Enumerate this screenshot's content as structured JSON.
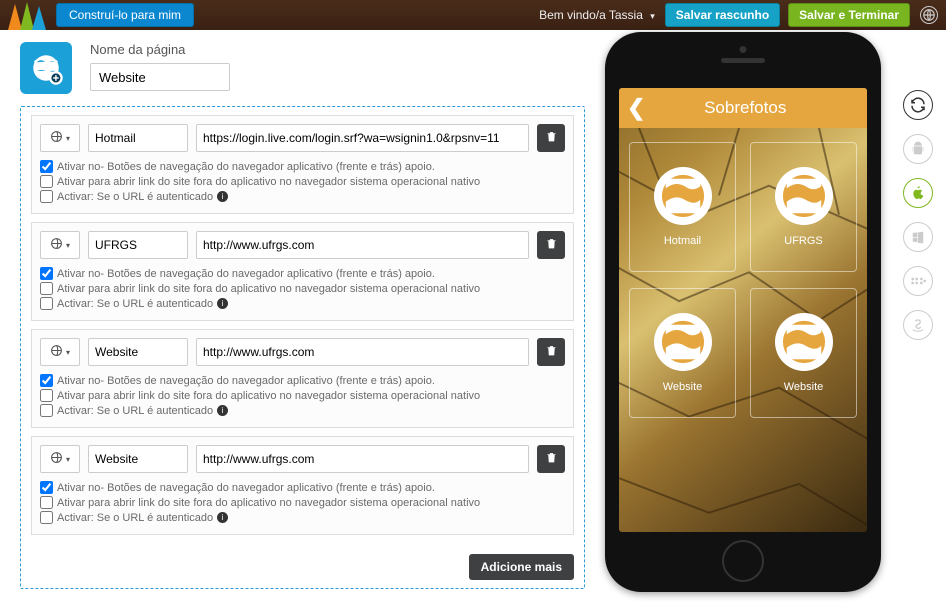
{
  "topbar": {
    "build_label": "Construí-lo para mim",
    "welcome": "Bem vindo/a Tassia",
    "save_draft": "Salvar rascunho",
    "save_finish": "Salvar e Terminar"
  },
  "page_head": {
    "label": "Nome da página",
    "value": "Website"
  },
  "checks": {
    "nav": "Ativar no- Botões de navegação do navegador aplicativo (frente e trás) apoio.",
    "ext": "Ativar para abrir link do site fora do aplicativo no navegador sistema operacional nativo",
    "auth": "Activar: Se o URL é autenticado"
  },
  "items": [
    {
      "name": "Hotmail",
      "url": "https://login.live.com/login.srf?wa=wsignin1.0&rpsnv=11",
      "nav": true,
      "ext": false,
      "auth": false
    },
    {
      "name": "UFRGS",
      "url": "http://www.ufrgs.com",
      "nav": true,
      "ext": false,
      "auth": false
    },
    {
      "name": "Website",
      "url": "http://www.ufrgs.com",
      "nav": true,
      "ext": false,
      "auth": false
    },
    {
      "name": "Website",
      "url": "http://www.ufrgs.com",
      "nav": true,
      "ext": false,
      "auth": false
    }
  ],
  "add_more": "Adicione mais",
  "preview": {
    "title": "Sobrefotos",
    "tiles": [
      {
        "label": "Hotmail"
      },
      {
        "label": "UFRGS"
      },
      {
        "label": "Website"
      },
      {
        "label": "Website"
      }
    ]
  }
}
